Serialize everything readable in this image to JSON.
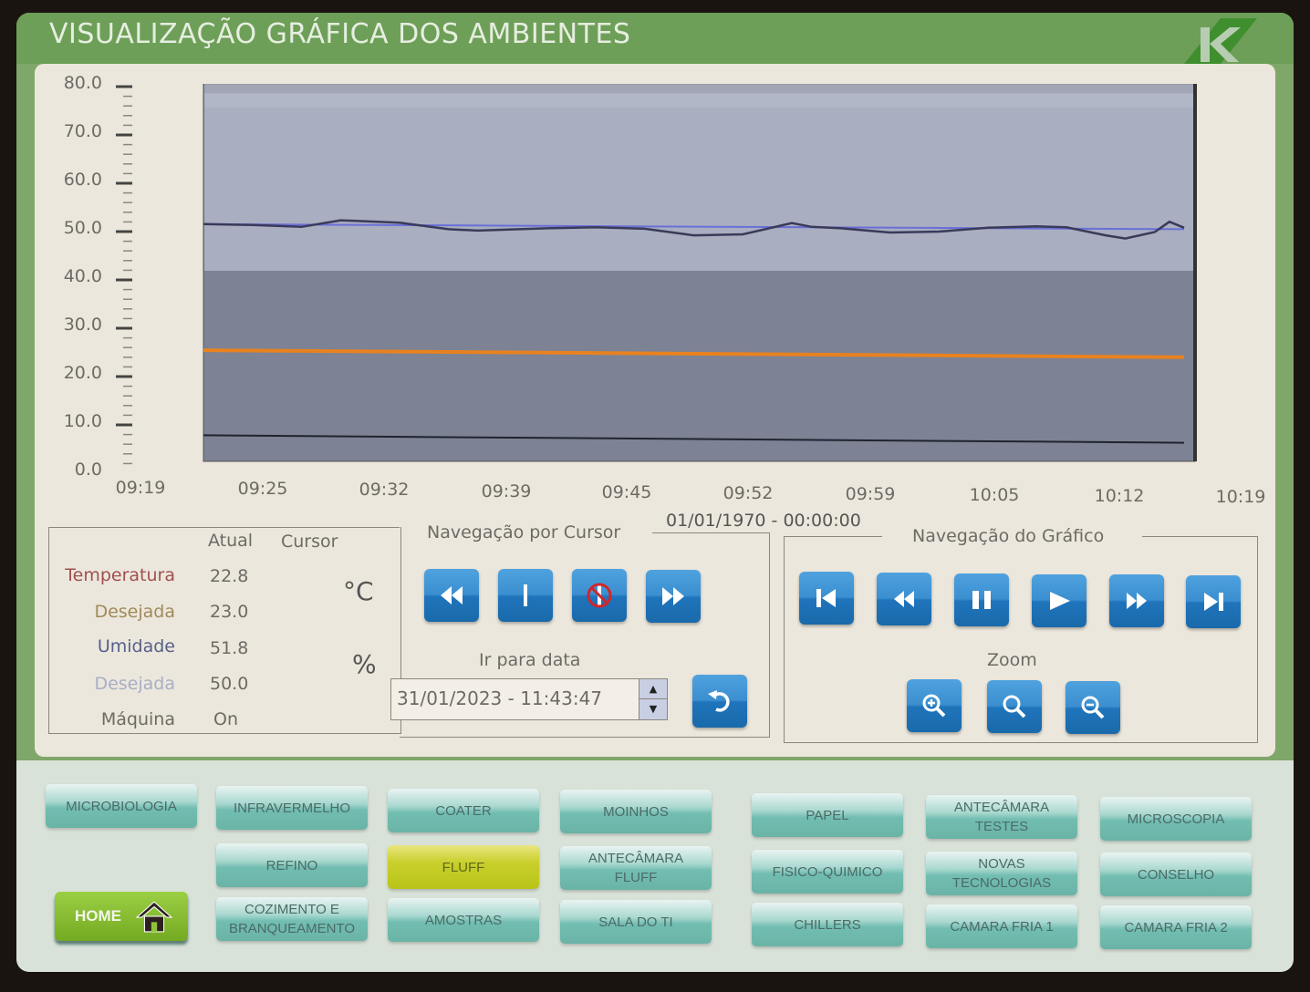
{
  "header": {
    "title": "VISUALIZAÇÃO GRÁFICA DOS AMBIENTES",
    "logo": "K-logo"
  },
  "chart_data": {
    "type": "line",
    "title": "",
    "xlabel": "",
    "ylabel": "",
    "ylim": [
      0,
      80
    ],
    "yticks": [
      "0.0",
      "10.0",
      "20.0",
      "30.0",
      "40.0",
      "50.0",
      "60.0",
      "70.0",
      "80.0"
    ],
    "xticks": [
      "09:19",
      "09:25",
      "09:32",
      "09:39",
      "09:45",
      "09:52",
      "09:59",
      "10:05",
      "10:12",
      "10:19"
    ],
    "grid": false,
    "bands": [
      {
        "from": 40,
        "to": 78,
        "color": "#a9aec0"
      },
      {
        "from": 0,
        "to": 40,
        "color": "#7d8294"
      }
    ],
    "series": [
      {
        "name": "Umidade",
        "color": "#3a3a5a",
        "x": [
          0,
          0.05,
          0.1,
          0.14,
          0.2,
          0.25,
          0.28,
          0.35,
          0.4,
          0.45,
          0.5,
          0.55,
          0.6,
          0.62,
          0.65,
          0.7,
          0.75,
          0.8,
          0.85,
          0.88,
          0.92,
          0.94,
          0.97,
          0.985,
          1.0
        ],
        "values": [
          50.0,
          49.8,
          49.4,
          50.8,
          50.3,
          48.9,
          48.6,
          49.1,
          49.3,
          49.0,
          47.6,
          47.8,
          50.2,
          49.4,
          49.1,
          48.2,
          48.4,
          49.2,
          49.5,
          49.3,
          47.6,
          46.9,
          48.3,
          50.5,
          49.2
        ]
      },
      {
        "name": "Umidade Desejada",
        "color": "#6a6fd8",
        "x": [
          0,
          1.0
        ],
        "values": [
          50.0,
          48.9
        ]
      },
      {
        "name": "Temperatura Desejada",
        "color": "#e8821f",
        "x": [
          0,
          1.0
        ],
        "values": [
          23.0,
          21.5
        ]
      },
      {
        "name": "Máquina",
        "color": "#1f2430",
        "x": [
          0,
          1.0
        ],
        "values": [
          4.8,
          3.2
        ]
      }
    ]
  },
  "cursor_date": "01/01/1970 - 00:00:00",
  "info": {
    "col_atual": "Atual",
    "col_cursor": "Cursor",
    "rows": [
      {
        "label": "Temperatura",
        "value": "22.8",
        "color": "#a05050"
      },
      {
        "label": "Desejada",
        "value": "23.0",
        "color": "#a08a5a"
      },
      {
        "label": "Umidade",
        "value": "51.8",
        "color": "#55608c"
      },
      {
        "label": "Desejada",
        "value": "50.0",
        "color": "#a8aec6"
      },
      {
        "label": "Máquina",
        "value": "On",
        "color": "#6d6a66"
      }
    ],
    "unit_temp": "°C",
    "unit_hum": "%"
  },
  "cursor_nav": {
    "title": "Navegação por Cursor",
    "buttons": [
      "rewind",
      "cursor",
      "cursor-disable",
      "fast-forward"
    ],
    "goto_label": "Ir para data",
    "goto_value": "31/01/2023 - 11:43:47"
  },
  "graph_nav": {
    "title": "Navegação do Gráfico",
    "buttons": [
      "skip-start",
      "rewind",
      "pause",
      "play",
      "fast-forward",
      "skip-end"
    ],
    "zoom_label": "Zoom"
  },
  "nav_buttons": {
    "home": "HOME",
    "items": [
      "MICROBIOLOGIA",
      "INFRAVERMELHO",
      "COATER",
      "MOINHOS",
      "PAPEL",
      "ANTECÂMARA\nTESTES",
      "MICROSCOPIA",
      "REFINO",
      "FLUFF",
      "ANTECÂMARA\nFLUFF",
      "FISICO-QUIMICO",
      "NOVAS\nTECNOLOGIAS",
      "CONSELHO",
      "COZIMENTO E\nBRANQUEAMENTO",
      "AMOSTRAS",
      "SALA DO TI",
      "CHILLERS",
      "CAMARA FRIA 1",
      "CAMARA FRIA 2"
    ],
    "active": "FLUFF"
  }
}
